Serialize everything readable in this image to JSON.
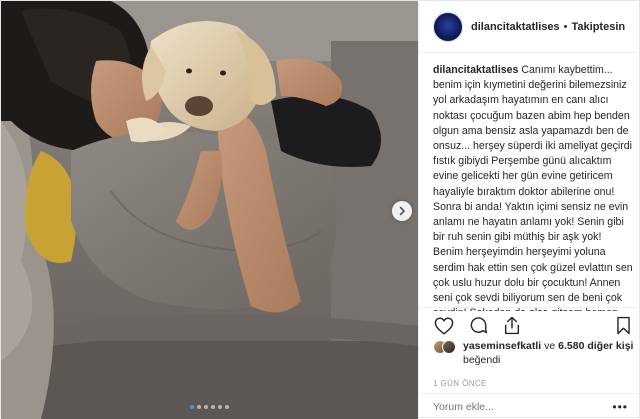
{
  "header": {
    "username": "dilancitaktatlises",
    "separator": "•",
    "follow_label": "Takiptesin"
  },
  "caption": {
    "username": "dilancitaktatlises",
    "text": "Canımı kaybettim... benim için kıymetini değerini bilemezsiniz yol arkadaşım hayatımın en canı alıcı noktası çocuğum bazen abim hep benden olgun ama bensiz asla yapamazdı ben de onsuz... herşey süperdi iki ameliyat geçirdi fıstık gibiydi Perşembe günü alıcaktım evine gelicekti her gün evine getiricem hayaliyle bıraktım doktor abilerine onu! Sonra bi anda! Yaktın içimi sensiz ne evin anlamı ne hayatın anlamı yok! Senin gibi bir ruh senin gibi müthiş bir aşk yok! Benim herşeyimdin herşeyimi yoluna serdim hak ettin sen çok güzel evlattın sen çok uslu huzur dolu bir çocuktun! Annen seni çok sevdi biliyorum sen de beni çok sevdin! Şakadan da olsa gitsem hemen havlar bensiz hiç kalamazdın ya da kitlerdin kendini götürmelerine izin vermezdin. Her gün senle vedalaşırken"
  },
  "likes": {
    "first_user": "yaseminsefkatli",
    "connector": "ve",
    "count_text": "6.580 diğer kişi",
    "suffix": "beğendi"
  },
  "timestamp": "1 GÜN ÖNCE",
  "comment": {
    "placeholder": "Yorum ekle...",
    "more_label": "•••"
  },
  "carousel": {
    "slide_count": 6,
    "active_index": 0
  },
  "colors": {
    "accent": "#3897f0",
    "text": "#262626",
    "muted": "#999999",
    "border": "#efefef"
  },
  "icons": {
    "like": "heart-icon",
    "comment": "comment-icon",
    "share": "share-icon",
    "save": "bookmark-icon",
    "next": "chevron-right-icon"
  }
}
